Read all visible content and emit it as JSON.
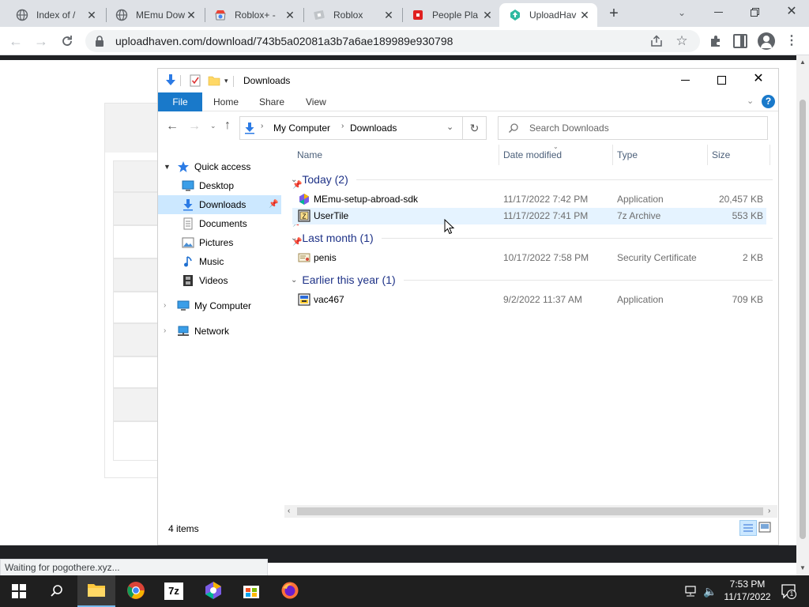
{
  "browser": {
    "tabs": [
      {
        "label": "Index of /",
        "icon": "globe-icon"
      },
      {
        "label": "MEmu Dow",
        "icon": "globe-icon"
      },
      {
        "label": "Roblox+ - ",
        "icon": "chrome-web-store-icon"
      },
      {
        "label": "Roblox",
        "icon": "roblox-icon"
      },
      {
        "label": "People Pla",
        "icon": "roblox-red-icon"
      },
      {
        "label": "UploadHav",
        "icon": "uploadhaven-icon"
      }
    ],
    "url": "uploadhaven.com/download/743b5a02081a3b7a6ae189989e930798",
    "status": "Waiting for pogothere.xyz..."
  },
  "explorer": {
    "title": "Downloads",
    "ribbon_tabs": [
      "File",
      "Home",
      "Share",
      "View"
    ],
    "breadcrumb": [
      "My Computer",
      "Downloads"
    ],
    "search_placeholder": "Search Downloads",
    "columns": [
      "Name",
      "Date modified",
      "Type",
      "Size"
    ],
    "nav": {
      "quick_access": "Quick access",
      "items": [
        "Desktop",
        "Downloads",
        "Documents",
        "Pictures",
        "Music",
        "Videos"
      ],
      "my_computer": "My Computer",
      "network": "Network"
    },
    "groups": [
      {
        "label": "Today (2)",
        "files": [
          {
            "name": "MEmu-setup-abroad-sdk",
            "date": "11/17/2022 7:42 PM",
            "type": "Application",
            "size": "20,457 KB"
          },
          {
            "name": "UserTile",
            "date": "11/17/2022 7:41 PM",
            "type": "7z Archive",
            "size": "553 KB"
          }
        ]
      },
      {
        "label": "Last month (1)",
        "files": [
          {
            "name": "penis",
            "date": "10/17/2022 7:58 PM",
            "type": "Security Certificate",
            "size": "2 KB"
          }
        ]
      },
      {
        "label": "Earlier this year (1)",
        "files": [
          {
            "name": "vac467",
            "date": "9/2/2022 11:37 AM",
            "type": "Application",
            "size": "709 KB"
          }
        ]
      }
    ],
    "status_count": "4 items"
  },
  "taskbar": {
    "time": "7:53 PM",
    "date": "11/17/2022",
    "notification_count": "1"
  },
  "colors": {
    "ribbon_file": "#1979ca",
    "selection": "#cce8ff",
    "hover": "#e5f3ff",
    "group_header": "#1e3287",
    "taskbar": "#1f1f1f"
  }
}
